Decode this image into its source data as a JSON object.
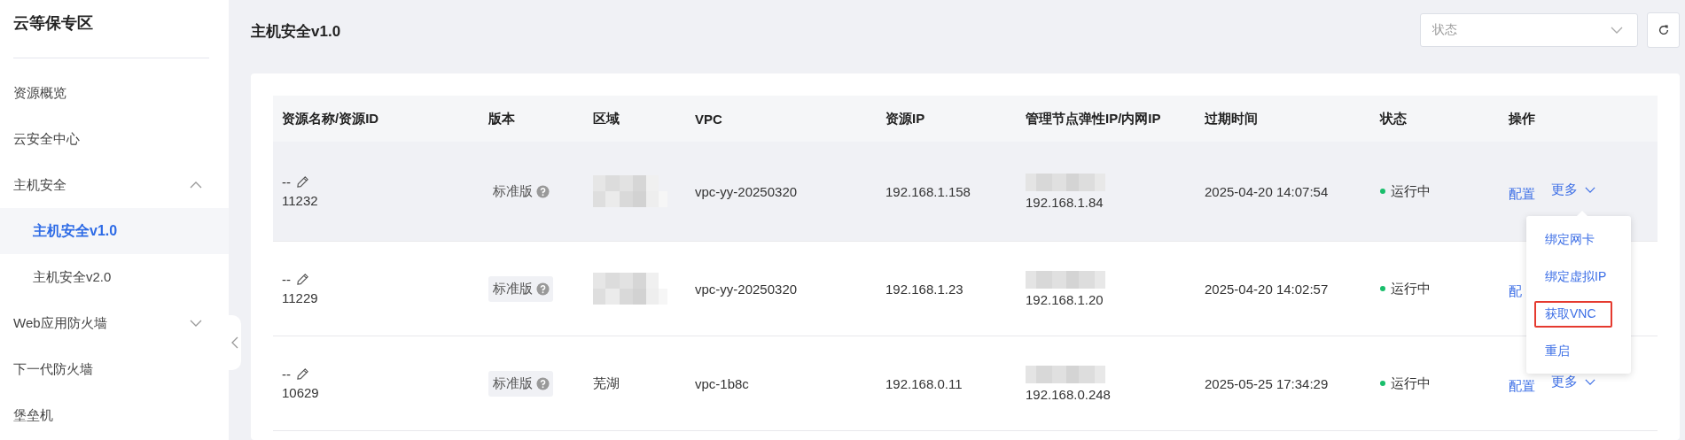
{
  "sidebar": {
    "title": "云等保专区",
    "items": [
      {
        "label": "资源概览",
        "selected": false
      },
      {
        "label": "云安全中心",
        "selected": false
      },
      {
        "label": "主机安全",
        "selected": false,
        "expanded": true,
        "children": [
          {
            "label": "主机安全v1.0",
            "selected": true
          },
          {
            "label": "主机安全v2.0",
            "selected": false
          }
        ]
      },
      {
        "label": "Web应用防火墙",
        "selected": false,
        "expanded": false
      },
      {
        "label": "下一代防火墙",
        "selected": false
      },
      {
        "label": "堡垒机",
        "selected": false
      }
    ]
  },
  "page": {
    "title": "主机安全v1.0",
    "status_filter": {
      "placeholder": "状态"
    }
  },
  "table": {
    "columns": [
      "资源名称/资源ID",
      "版本",
      "区域",
      "VPC",
      "资源IP",
      "管理节点弹性IP/内网IP",
      "过期时间",
      "状态",
      "操作"
    ],
    "rows": [
      {
        "name": "--",
        "id": "11232",
        "edition": "标准版",
        "edition_tag": false,
        "region_blurred": true,
        "vpc": "vpc-yy-20250320",
        "ip": "192.168.1.158",
        "mgmt_ip": "192.168.1.84",
        "expires": "2025-04-20 14:07:54",
        "status": "运行中",
        "color": "#19be6b",
        "hovered": true,
        "actions": [
          {
            "kind": "link",
            "label": "配置"
          },
          {
            "kind": "menu",
            "label": "更多"
          }
        ]
      },
      {
        "name": "--",
        "id": "11229",
        "edition": "标准版",
        "edition_tag": true,
        "region_blurred": true,
        "vpc": "vpc-yy-20250320",
        "ip": "192.168.1.23",
        "mgmt_ip": "192.168.1.20",
        "expires": "2025-04-20 14:02:57",
        "status": "运行中",
        "color": "#19be6b",
        "hovered": false,
        "actions": [
          {
            "kind": "link",
            "label": "配"
          }
        ]
      },
      {
        "name": "--",
        "id": "10629",
        "edition": "标准版",
        "edition_tag": true,
        "region_blurred": false,
        "region": "芜湖",
        "vpc": "vpc-1b8c",
        "ip": "192.168.0.11",
        "mgmt_ip": "192.168.0.248",
        "expires": "2025-05-25 17:34:29",
        "status": "运行中",
        "color": "#19be6b",
        "hovered": false,
        "actions": [
          {
            "kind": "link",
            "label": "配置"
          },
          {
            "kind": "menu",
            "label": "更多"
          }
        ]
      }
    ]
  },
  "more_menu": {
    "items": [
      {
        "label": "绑定网卡",
        "highlighted": false
      },
      {
        "label": "绑定虚拟IP",
        "highlighted": false
      },
      {
        "label": "获取VNC",
        "highlighted": true
      },
      {
        "label": "重启",
        "highlighted": false
      }
    ]
  }
}
